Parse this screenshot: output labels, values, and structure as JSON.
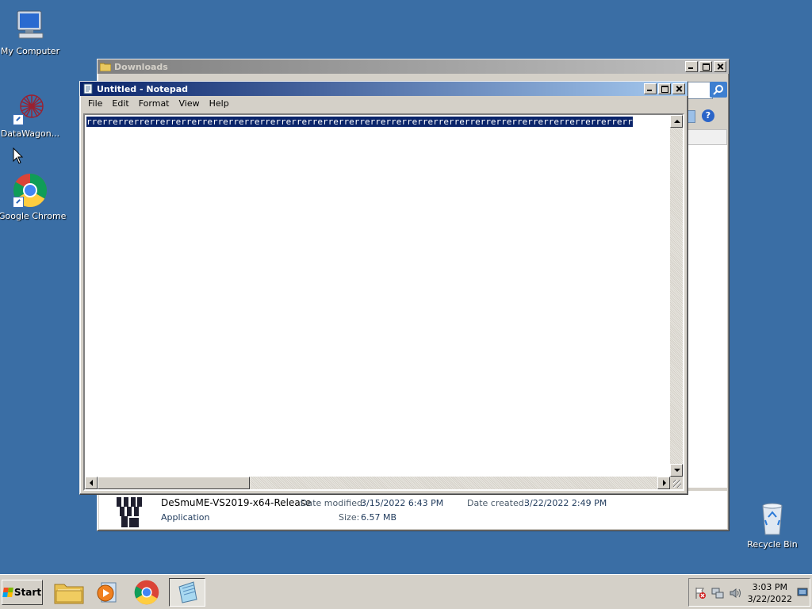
{
  "desktop": {
    "icons": [
      {
        "label": "My Computer",
        "icon": "computer-icon"
      },
      {
        "label": "DataWagon...",
        "icon": "datawagon-icon"
      },
      {
        "label": "Google Chrome",
        "icon": "chrome-icon"
      },
      {
        "label": "Recycle Bin",
        "icon": "recycle-bin-icon"
      }
    ]
  },
  "explorer": {
    "title": "Downloads",
    "selected_file": {
      "name": "DeSmuME-VS2019-x64-Release",
      "type": "Application",
      "date_modified_label": "Date modified:",
      "date_modified": "3/15/2022 6:43 PM",
      "size_label": "Size:",
      "size": "6.57 MB",
      "date_created_label": "Date created:",
      "date_created": "3/22/2022 2:49 PM"
    }
  },
  "notepad": {
    "title": "Untitled - Notepad",
    "menu": [
      "File",
      "Edit",
      "Format",
      "View",
      "Help"
    ],
    "content": "rrerrerrerrerrerrerrerrerrerrerrerrerrerrerrerrerrerrerrerrerrerrerrerrerrerrerrerrerrerrerrerrerrerrerr"
  },
  "taskbar": {
    "start_label": "Start",
    "items": [
      "explorer-icon",
      "media-player-icon",
      "chrome-icon",
      "notepad-icon"
    ],
    "active_item": "notepad-icon",
    "clock_time": "3:03 PM",
    "clock_date": "3/22/2022"
  },
  "colors": {
    "desktop": "#3a6ea5",
    "active_title": "#0a246a",
    "selection": "#0a246a"
  }
}
